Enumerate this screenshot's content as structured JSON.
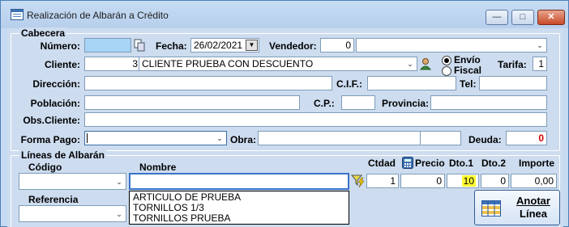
{
  "window": {
    "title": "Realización de Albarán a Crédito",
    "minimize": "—",
    "maximize": "□",
    "close": "✕"
  },
  "header": {
    "legend": "Cabecera",
    "numero_label": "Número:",
    "numero_value": "",
    "fecha_label": "Fecha:",
    "fecha_value": "26/02/2021",
    "vendedor_label": "Vendedor:",
    "vendedor_code": "0",
    "vendedor_name": "",
    "cliente_label": "Cliente:",
    "cliente_code": "3",
    "cliente_name": "CLIENTE PRUEBA CON DESCUENTO",
    "envio_label": "Envío",
    "fiscal_label": "Fiscal",
    "envio_selected": true,
    "tarifa_label": "Tarifa:",
    "tarifa_value": "1",
    "direccion_label": "Dirección:",
    "direccion_value": "",
    "cif_label": "C.I.F.:",
    "cif_value": "",
    "tel_label": "Tel:",
    "tel_value": "",
    "poblacion_label": "Población:",
    "poblacion_value": "",
    "cp_label": "C.P.:",
    "cp_value": "",
    "provincia_label": "Provincia:",
    "provincia_value": "",
    "obs_label": "Obs.Cliente:",
    "obs_value": "",
    "forma_pago_label": "Forma Pago:",
    "forma_pago_value": "",
    "obra_label": "Obra:",
    "obra_value": "",
    "obra_extra": "",
    "deuda_label": "Deuda:",
    "deuda_value": "0",
    "deuda_color": "#d40000"
  },
  "lines": {
    "legend": "Líneas de Albarán",
    "codigo_label": "Código",
    "codigo_value": "",
    "nombre_label": "Nombre",
    "nombre_value": "",
    "ctdad_label": "Ctdad",
    "ctdad_value": "1",
    "precio_label": "Precio",
    "precio_value": "0",
    "dto1_label": "Dto.1",
    "dto1_value": "10",
    "dto1_highlight": "#ffff33",
    "dto2_label": "Dto.2",
    "dto2_value": "0",
    "importe_label": "Importe",
    "importe_value": "0,00",
    "referencia_label": "Referencia",
    "referencia_value": "",
    "suggestions": [
      "ARTICULO DE PRUEBA",
      "TORNILLOS 1/3",
      "TORNILLOS PRUEBA"
    ],
    "anotar_line1": "Anotar",
    "anotar_line2": "Línea"
  },
  "icons": [
    "window-app-icon",
    "copy-icon",
    "client-person-icon",
    "filter-lightning-icon",
    "calculator-icon",
    "table-grid-icon"
  ]
}
